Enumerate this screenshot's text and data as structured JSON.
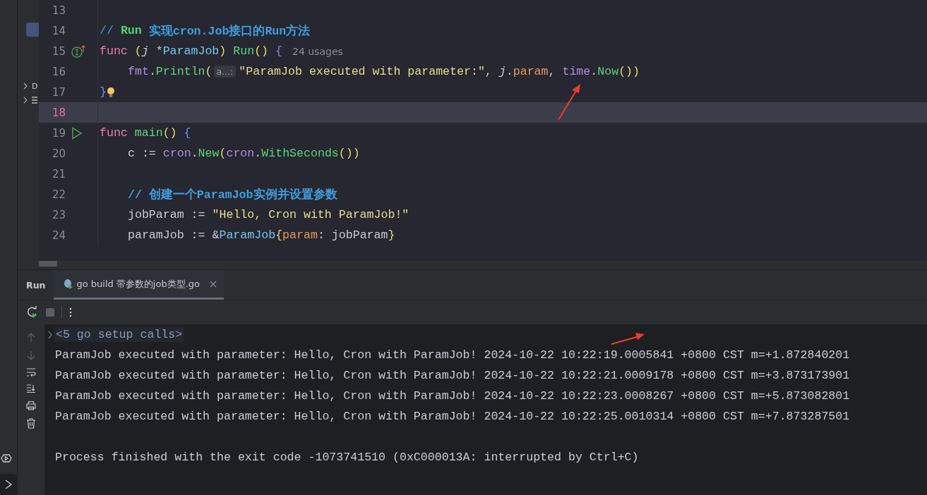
{
  "sidebar": {
    "tree": [
      {
        "label": "D",
        "kind": "folder"
      },
      {
        "kind": "file"
      }
    ]
  },
  "editor": {
    "lines": [
      {
        "number": "13",
        "selected": false,
        "kind": "code"
      },
      {
        "number": "14",
        "selected": false,
        "kind": "code",
        "indented": false,
        "tokens": [
          {
            "t": "//",
            "kind": "comment"
          },
          {
            "t": " Run",
            "kind": "doc-tag"
          },
          {
            "t": " 实现cron.Job接口的Run方法",
            "kind": "doc"
          }
        ]
      },
      {
        "number": "15",
        "selected": false,
        "kind": "implements",
        "indented": false,
        "tokens": [
          {
            "t": "func",
            "kind": "keyword"
          },
          {
            "t": " (",
            "kind": "paren"
          },
          {
            "t": "j",
            "kind": "receiver"
          },
          {
            "t": " *",
            "kind": "plain"
          },
          {
            "t": "ParamJob",
            "kind": "type"
          },
          {
            "t": ")",
            "kind": "paren"
          },
          {
            "t": " Run",
            "kind": "func"
          },
          {
            "t": "()",
            "kind": "paren"
          },
          {
            "t": " {",
            "kind": "brace"
          },
          {
            "t": "24 usages",
            "kind": "inlay"
          }
        ]
      },
      {
        "number": "16",
        "selected": false,
        "kind": "code",
        "indented": true,
        "tokens": [
          {
            "t": "fmt",
            "kind": "pkg"
          },
          {
            "t": ".",
            "kind": "plain"
          },
          {
            "t": "Println",
            "kind": "func"
          },
          {
            "t": "(",
            "kind": "paren"
          },
          {
            "t": "a...:",
            "kind": "hint"
          },
          {
            "t": "\"ParamJob executed with parameter:\"",
            "kind": "string"
          },
          {
            "t": ",",
            "kind": "plain"
          },
          {
            "t": " j",
            "kind": "receiver"
          },
          {
            "t": ".",
            "kind": "plain"
          },
          {
            "t": "param",
            "kind": "field"
          },
          {
            "t": ",",
            "kind": "plain"
          },
          {
            "t": " time",
            "kind": "pkg"
          },
          {
            "t": ".",
            "kind": "plain"
          },
          {
            "t": "Now",
            "kind": "func"
          },
          {
            "t": "())",
            "kind": "paren"
          }
        ]
      },
      {
        "number": "17",
        "selected": false,
        "kind": "bulb",
        "indented": false,
        "tokens": [
          {
            "t": "}",
            "kind": "brace"
          }
        ]
      },
      {
        "number": "18",
        "selected": true,
        "kind": "code"
      },
      {
        "number": "19",
        "selected": false,
        "kind": "run",
        "indented": false,
        "tokens": [
          {
            "t": "func",
            "kind": "keyword"
          },
          {
            "t": " main",
            "kind": "func"
          },
          {
            "t": "()",
            "kind": "paren"
          },
          {
            "t": " {",
            "kind": "brace"
          }
        ]
      },
      {
        "number": "20",
        "selected": false,
        "kind": "code",
        "indented": true,
        "tokens": [
          {
            "t": "c :=",
            "kind": "plain"
          },
          {
            "t": " cron",
            "kind": "pkg"
          },
          {
            "t": ".",
            "kind": "plain"
          },
          {
            "t": "New",
            "kind": "func"
          },
          {
            "t": "(",
            "kind": "paren"
          },
          {
            "t": "cron",
            "kind": "pkg"
          },
          {
            "t": ".",
            "kind": "plain"
          },
          {
            "t": "WithSeconds",
            "kind": "func"
          },
          {
            "t": "())",
            "kind": "paren"
          }
        ]
      },
      {
        "number": "21",
        "selected": false,
        "kind": "code"
      },
      {
        "number": "22",
        "selected": false,
        "kind": "code",
        "indented": true,
        "tokens": [
          {
            "t": "// 创建一个ParamJob实例并设置参数",
            "kind": "doc"
          }
        ]
      },
      {
        "number": "23",
        "selected": false,
        "kind": "code",
        "indented": true,
        "tokens": [
          {
            "t": "jobParam :=",
            "kind": "plain"
          },
          {
            "t": " \"Hello, Cron with ParamJob!\"",
            "kind": "string"
          }
        ]
      },
      {
        "number": "24",
        "selected": false,
        "kind": "code",
        "indented": true,
        "tokens": [
          {
            "t": "paramJob := &",
            "kind": "plain"
          },
          {
            "t": "ParamJob",
            "kind": "type"
          },
          {
            "t": "{",
            "kind": "paren"
          },
          {
            "t": "param",
            "kind": "field"
          },
          {
            "t": ": jobParam",
            "kind": "plain"
          },
          {
            "t": "}",
            "kind": "paren"
          }
        ]
      }
    ]
  },
  "run_panel": {
    "title": "Run",
    "tabs": [
      {
        "label": "go build 带参数的job类型.go",
        "selected": true
      }
    ],
    "console": {
      "fold": "<5 go setup calls>",
      "lines": [
        "ParamJob executed with parameter: Hello, Cron with ParamJob! 2024-10-22 10:22:19.0005841 +0800 CST m=+1.872840201",
        "ParamJob executed with parameter: Hello, Cron with ParamJob! 2024-10-22 10:22:21.0009178 +0800 CST m=+3.873173901",
        "ParamJob executed with parameter: Hello, Cron with ParamJob! 2024-10-22 10:22:23.0008267 +0800 CST m=+5.873082801",
        "ParamJob executed with parameter: Hello, Cron with ParamJob! 2024-10-22 10:22:25.0010314 +0800 CST m=+7.873287501"
      ],
      "exit_message": "Process finished with the exit code -1073741510 (0xC000013A: interrupted by Ctrl+C)"
    }
  }
}
